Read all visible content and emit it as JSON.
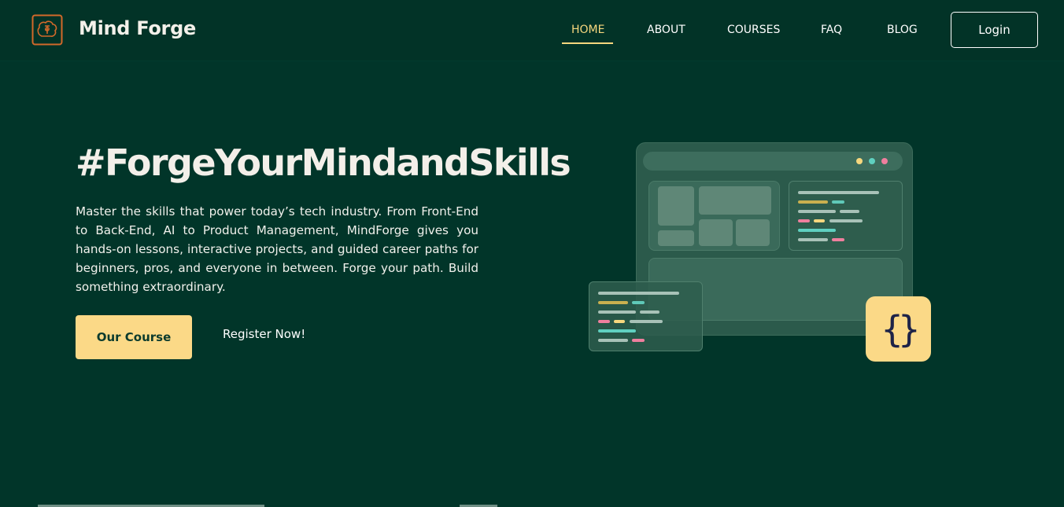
{
  "header": {
    "brand": "Mind Forge",
    "nav": [
      {
        "label": "HOME",
        "active": true
      },
      {
        "label": "ABOUT",
        "active": false
      },
      {
        "label": "COURSES",
        "active": false
      },
      {
        "label": "FAQ",
        "active": false
      },
      {
        "label": "BLOG",
        "active": false
      }
    ],
    "login_label": "Login"
  },
  "hero": {
    "title": "#ForgeYourMindandSkills",
    "description": "Master the skills that power today’s tech industry. From Front-End to Back-End, AI to Product Management, MindForge gives you hands-on lessons, interactive projects, and guided career paths for beginners, pros, and everyone in between. Forge your path. Build something extraordinary.",
    "primary_cta": "Our Course",
    "secondary_cta": "Register Now!"
  },
  "illustration": {
    "badge_text": "{}",
    "window_dots": [
      "#f6d77e",
      "#5fd0c0",
      "#ef7f9e"
    ]
  },
  "colors": {
    "background": "#013529",
    "accent": "#fbd987",
    "active_nav": "#f6d77e",
    "logo_orange": "#d2692a"
  },
  "icons": {
    "logo": "brain-gear-icon"
  }
}
